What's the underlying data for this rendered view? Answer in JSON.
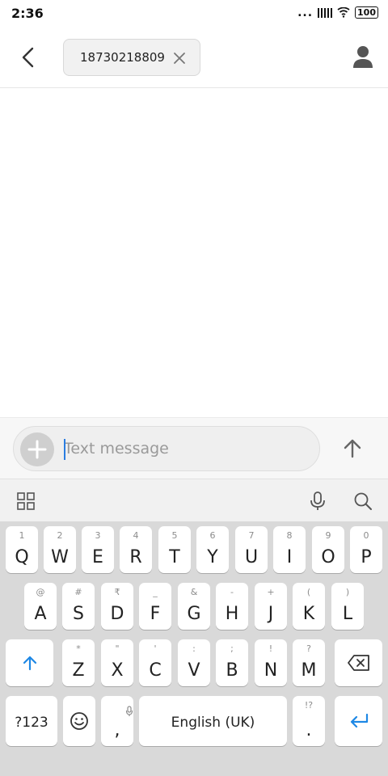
{
  "status": {
    "time": "2:36",
    "dots": "...",
    "battery": "100",
    "icons": [
      "signal-icon",
      "wifi-icon",
      "battery-icon"
    ]
  },
  "header": {
    "back_icon": "back-arrow-icon",
    "recipient": "18730218809",
    "chip_close_icon": "close-icon",
    "contact_icon": "contact-icon"
  },
  "compose": {
    "placeholder": "Text message",
    "add_icon": "plus-icon",
    "send_icon": "send-arrow-icon"
  },
  "toolbar": {
    "icons": [
      "apps-grid-icon",
      "microphone-icon",
      "search-icon"
    ]
  },
  "keyboard": {
    "row1": [
      {
        "label": "Q",
        "hint": "1"
      },
      {
        "label": "W",
        "hint": "2"
      },
      {
        "label": "E",
        "hint": "3"
      },
      {
        "label": "R",
        "hint": "4"
      },
      {
        "label": "T",
        "hint": "5"
      },
      {
        "label": "Y",
        "hint": "6"
      },
      {
        "label": "U",
        "hint": "7"
      },
      {
        "label": "I",
        "hint": "8"
      },
      {
        "label": "O",
        "hint": "9"
      },
      {
        "label": "P",
        "hint": "0"
      }
    ],
    "row2": [
      {
        "label": "A",
        "hint": "@"
      },
      {
        "label": "S",
        "hint": "#"
      },
      {
        "label": "D",
        "hint": "₹"
      },
      {
        "label": "F",
        "hint": "_"
      },
      {
        "label": "G",
        "hint": "&"
      },
      {
        "label": "H",
        "hint": "-"
      },
      {
        "label": "J",
        "hint": "+"
      },
      {
        "label": "K",
        "hint": "("
      },
      {
        "label": "L",
        "hint": ")"
      }
    ],
    "row3": [
      {
        "label": "Z",
        "hint": "*"
      },
      {
        "label": "X",
        "hint": "\""
      },
      {
        "label": "C",
        "hint": "'"
      },
      {
        "label": "V",
        "hint": ":"
      },
      {
        "label": "B",
        "hint": ";"
      },
      {
        "label": "N",
        "hint": "!"
      },
      {
        "label": "M",
        "hint": "?"
      }
    ],
    "symbols_label": "?123",
    "comma_label": ",",
    "space_label": "English (UK)",
    "period_label": ".",
    "period_hint": "!?",
    "accent_color": "#1e88e5"
  }
}
